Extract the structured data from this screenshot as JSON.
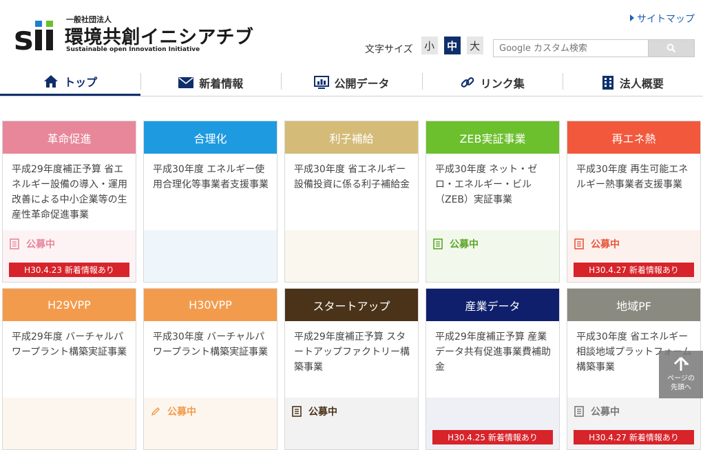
{
  "logo": {
    "mark": "sii",
    "org_type": "一般社団法人",
    "name": "環境共創イニシアチブ",
    "sub": "Sustainable open Innovation Initiative"
  },
  "header": {
    "sitemap_label": "サイトマップ",
    "font_size_label": "文字サイズ",
    "font_sizes": [
      "小",
      "中",
      "大"
    ],
    "font_size_selected": "中",
    "search_placeholder": "Google カスタム検索"
  },
  "nav": {
    "items": [
      {
        "label": "トップ",
        "icon": "home-icon"
      },
      {
        "label": "新着情報",
        "icon": "mail-icon"
      },
      {
        "label": "公開データ",
        "icon": "monitor-chart-icon"
      },
      {
        "label": "リンク集",
        "icon": "link-icon"
      },
      {
        "label": "法人概要",
        "icon": "building-icon"
      }
    ],
    "active": "トップ"
  },
  "colors": {
    "navy": "#0f2f6b",
    "badge_red": "#d7232a"
  },
  "cards": [
    {
      "title": "革命促進",
      "color": "#e8869a",
      "desc": "平成29年度補正予算 省エネルギー設備の導入・運用改善による中小企業等の生産性革命促進事業",
      "status": "公募中",
      "status_color": "#e8869a",
      "foot_bg": "#fdf3f5",
      "news": "H30.4.23 新着情報あり",
      "icon": "document-icon"
    },
    {
      "title": "合理化",
      "color": "#1e9ae0",
      "desc": "平成30年度 エネルギー使用合理化等事業者支援事業",
      "status": "",
      "status_color": "",
      "foot_bg": "#eef6fc",
      "news": "",
      "icon": ""
    },
    {
      "title": "利子補給",
      "color": "#d4bb78",
      "desc": "平成30年度 省エネルギー設備投資に係る利子補給金",
      "status": "",
      "status_color": "",
      "foot_bg": "#faf7ef",
      "news": "",
      "icon": ""
    },
    {
      "title": "ZEB実証事業",
      "color": "#6cbf2d",
      "desc": "平成30年度 ネット・ゼロ・エネルギー・ビル（ZEB）実証事業",
      "status": "公募中",
      "status_color": "#5ba52a",
      "foot_bg": "#f2f9ec",
      "news": "",
      "icon": "document-icon"
    },
    {
      "title": "再エネ熱",
      "color": "#f2583c",
      "desc": "平成30年度 再生可能エネルギー熱事業者支援事業",
      "status": "公募中",
      "status_color": "#e8553a",
      "foot_bg": "#fdf1ee",
      "news": "H30.4.27 新着情報あり",
      "icon": "document-icon"
    },
    {
      "title": "H29VPP",
      "color": "#f39b4c",
      "desc": "平成29年度 バーチャルパワープラント構築実証事業",
      "status": "",
      "status_color": "",
      "foot_bg": "#fdf6ef",
      "news": "",
      "icon": ""
    },
    {
      "title": "H30VPP",
      "color": "#f39b4c",
      "desc": "平成30年度 バーチャルパワープラント構築実証事業",
      "status": "公募中",
      "status_color": "#f39b4c",
      "foot_bg": "#fdf6ef",
      "news": "",
      "icon": "pencil-icon"
    },
    {
      "title": "スタートアップ",
      "color": "#4a3319",
      "desc": "平成29年度補正予算 スタートアップファクトリー構築事業",
      "status": "公募中",
      "status_color": "#4a3319",
      "foot_bg": "#f2f2f2",
      "news": "",
      "icon": "document-icon"
    },
    {
      "title": "産業データ",
      "color": "#0f1f6b",
      "desc": "平成29年度補正予算 産業データ共有促進事業費補助金",
      "status": "",
      "status_color": "",
      "foot_bg": "#eff0f5",
      "news": "H30.4.25 新着情報あり",
      "icon": ""
    },
    {
      "title": "地域PF",
      "color": "#8a8a80",
      "desc": "平成30年度 省エネルギー相談地域プラットフォーム構築事業",
      "status": "公募中",
      "status_color": "#777",
      "foot_bg": "#f3f3f3",
      "news": "H30.4.27 新着情報あり",
      "icon": "document-icon"
    }
  ],
  "pagetop": {
    "line1": "ページの",
    "line2": "先頭へ"
  }
}
